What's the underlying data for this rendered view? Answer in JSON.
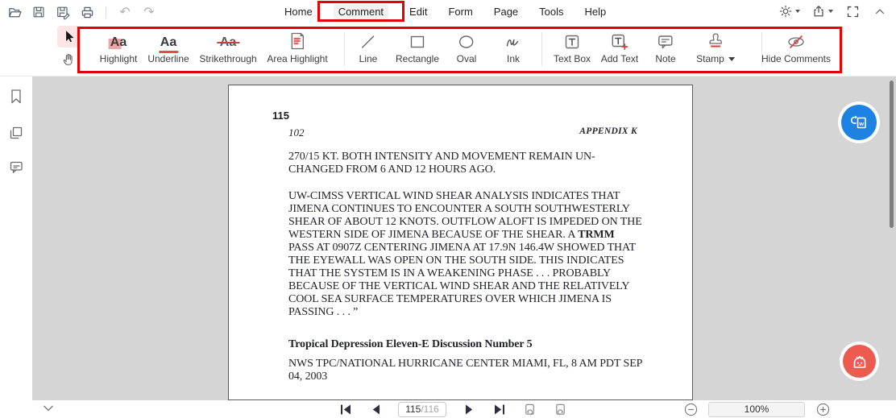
{
  "colors": {
    "annotation_red": "#e60000",
    "active_tab_underline": "#c81414",
    "fab_blue": "#1d82e2",
    "fab_red": "#ec5b50",
    "page_background": "#d5d5d5"
  },
  "menu": {
    "items": [
      "Home",
      "Comment",
      "Edit",
      "Form",
      "Page",
      "Tools",
      "Help"
    ],
    "active": "Comment"
  },
  "ribbon": {
    "tools": [
      "Highlight",
      "Underline",
      "Strikethrough",
      "Area Highlight",
      "Line",
      "Rectangle",
      "Oval",
      "Ink",
      "Text Box",
      "Add Text",
      "Note",
      "Stamp",
      "Hide Comments"
    ]
  },
  "document": {
    "page_label": "115",
    "header_left": "102",
    "header_right": "APPENDIX K",
    "para1_lines": [
      "270/15 KT. BOTH INTENSITY AND MOVEMENT REMAIN UN-",
      "CHANGED FROM 6 AND 12 HOURS AGO."
    ],
    "para2_lines": [
      "UW-CIMSS VERTICAL WIND SHEAR ANALYSIS INDICATES THAT",
      "JIMENA CONTINUES TO ENCOUNTER A SOUTH SOUTHWESTERLY",
      "SHEAR OF ABOUT 12 KNOTS. OUTFLOW ALOFT IS IMPEDED ON THE",
      "WESTERN SIDE OF JIMENA BECAUSE OF THE SHEAR. A **TRMM**",
      "PASS AT 0907Z CENTERING JIMENA AT 17.9N 146.4W SHOWED THAT",
      "THE EYEWALL WAS OPEN ON THE SOUTH SIDE. THIS INDICATES",
      "THAT THE SYSTEM IS IN A WEAKENING PHASE . . . PROBABLY",
      "BECAUSE OF THE VERTICAL WIND SHEAR AND THE RELATIVELY",
      "COOL SEA SURFACE TEMPERATURES OVER WHICH JIMENA IS",
      "PASSING . . . ”"
    ],
    "heading": "Tropical Depression Eleven-E Discussion Number 5",
    "footer_lines": [
      "NWS TPC/NATIONAL HURRICANE CENTER MIAMI, FL, 8 AM PDT SEP",
      "04, 2003"
    ]
  },
  "statusbar": {
    "current_page": "115",
    "page_separator": "/",
    "total_pages": "116",
    "zoom_level": "100%"
  }
}
